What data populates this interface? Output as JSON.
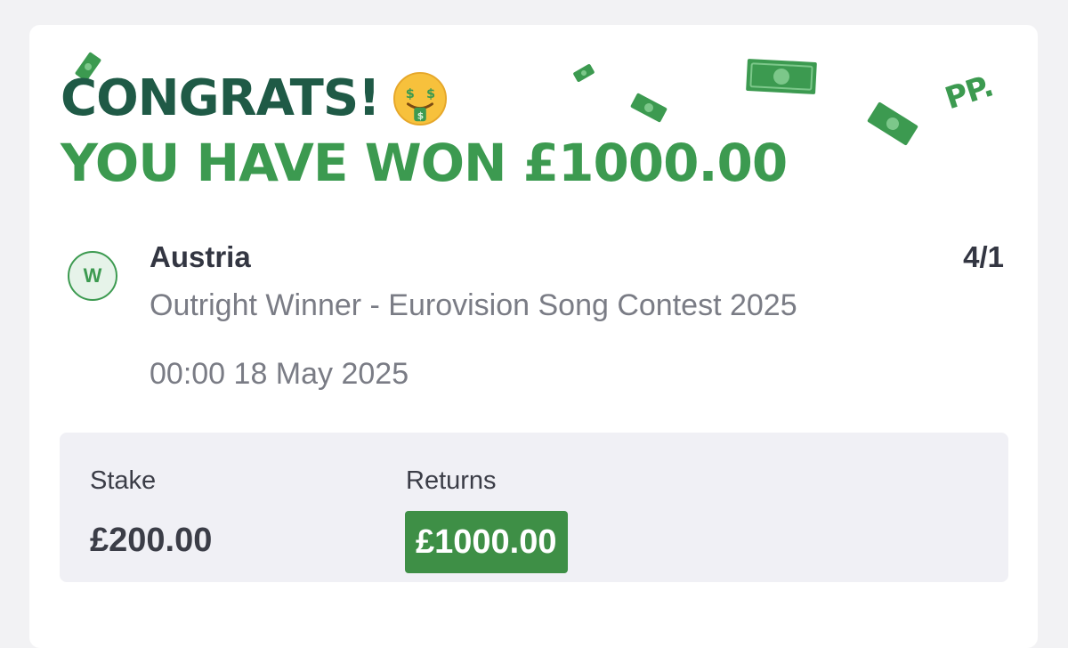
{
  "header": {
    "congrats": "CONGRATS!",
    "congrats_icon": "money-mouth-face-icon",
    "won_text": "YOU HAVE WON £1000.00",
    "brand_logo": "PP."
  },
  "bet": {
    "result_badge": "W",
    "selection": "Austria",
    "odds": "4/1",
    "market": "Outright Winner - Eurovision Song Contest 2025",
    "event_time": "00:00 18 May 2025"
  },
  "summary": {
    "stake_label": "Stake",
    "stake_value": "£200.00",
    "returns_label": "Returns",
    "returns_value": "£1000.00"
  },
  "colors": {
    "brand_dark_green": "#1f5a46",
    "brand_green": "#3c9a50",
    "returns_bg": "#3e8f46"
  }
}
